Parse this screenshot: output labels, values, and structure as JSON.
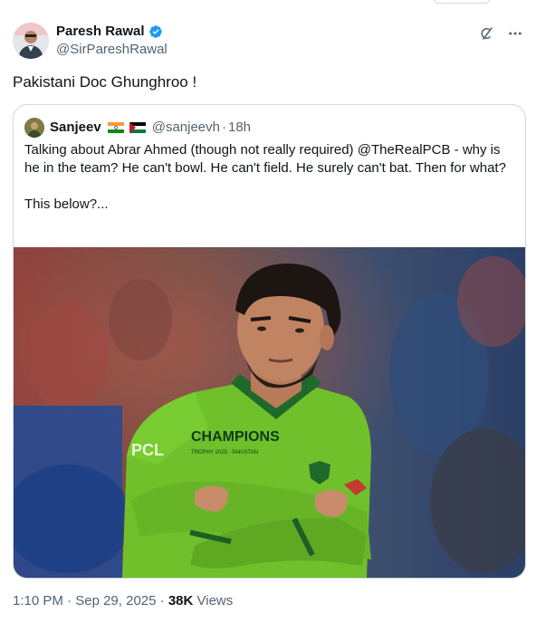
{
  "author": {
    "name": "Paresh Rawal",
    "handle": "@SirPareshRawal",
    "verified": true,
    "avatar_icon": "profile-photo"
  },
  "header_actions": {
    "grok_icon": "grok-icon",
    "more_icon": "more-horizontal-icon"
  },
  "tweet": {
    "text": "Pakistani Doc Ghunghroo !"
  },
  "quoted_tweet": {
    "author_name": "Sanjeev",
    "flags": [
      "india-flag",
      "palestine-flag"
    ],
    "handle": "@sanjeevh",
    "separator": "·",
    "time": "18h",
    "body_line1": "Talking about Abrar Ahmed (though not really required) @TheRealPCB  - why is he in the team? He can't bowl. He can't field. He surely can't bat. Then for what?",
    "body_line2": "This below?...",
    "image": {
      "jersey_text": "CHAMPIONS",
      "jersey_subtext": "TROPHY 2025 · PAKISTAN",
      "sponsor_text": "PCL"
    }
  },
  "meta": {
    "time": "1:10 PM",
    "separator": "·",
    "date": "Sep 29, 2025",
    "views_count": "38K",
    "views_label": "Views"
  },
  "colors": {
    "text_primary": "#0f1419",
    "text_secondary": "#536471",
    "verified_blue": "#1d9bf0",
    "border": "#cfd9de",
    "jersey_green": "#6fc02a"
  }
}
